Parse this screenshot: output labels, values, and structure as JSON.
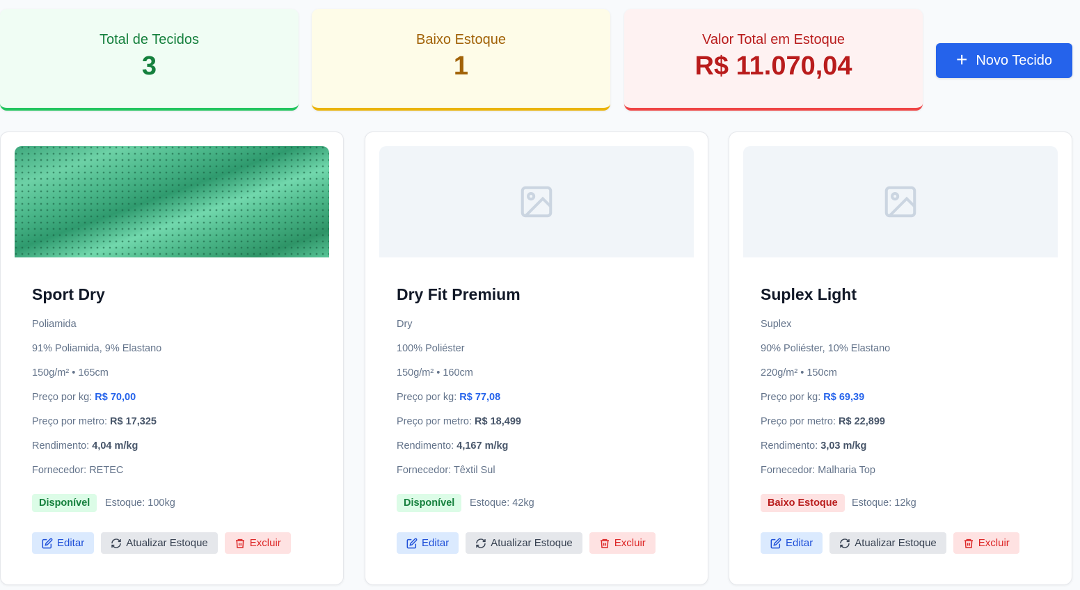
{
  "stats": {
    "total_label": "Total de Tecidos",
    "total_value": "3",
    "low_label": "Baixo Estoque",
    "low_value": "1",
    "value_label": "Valor Total em Estoque",
    "value_value": "R$ 11.070,04"
  },
  "new_button_label": "Novo Tecido",
  "colors": {
    "primary": "#2563eb",
    "green": "#22c55e",
    "yellow": "#eab308",
    "red": "#ef4444"
  },
  "cards": [
    {
      "name": "Sport Dry",
      "type": "Poliamida",
      "composition": "91% Poliamida, 9% Elastano",
      "specs": "150g/m² • 165cm",
      "price_kg_label": "Preço por kg:",
      "price_kg": "R$ 70,00",
      "price_m_label": "Preço por metro:",
      "price_m": "R$ 17,325",
      "yield_label": "Rendimento:",
      "yield": "4,04 m/kg",
      "supplier": "Fornecedor: RETEC",
      "status": "Disponível",
      "stock": "Estoque: 100kg",
      "edit": "Editar",
      "update": "Atualizar Estoque",
      "delete": "Excluir",
      "image": "green-fabric-photo"
    },
    {
      "name": "Dry Fit Premium",
      "type": "Dry",
      "composition": "100% Poliéster",
      "specs": "150g/m² • 160cm",
      "price_kg_label": "Preço por kg:",
      "price_kg": "R$ 77,08",
      "price_m_label": "Preço por metro:",
      "price_m": "R$ 18,499",
      "yield_label": "Rendimento:",
      "yield": "4,167 m/kg",
      "supplier": "Fornecedor: Têxtil Sul",
      "status": "Disponível",
      "stock": "Estoque: 42kg",
      "edit": "Editar",
      "update": "Atualizar Estoque",
      "delete": "Excluir",
      "image": "image-placeholder-icon"
    },
    {
      "name": "Suplex Light",
      "type": "Suplex",
      "composition": "90% Poliéster, 10% Elastano",
      "specs": "220g/m² • 150cm",
      "price_kg_label": "Preço por kg:",
      "price_kg": "R$ 69,39",
      "price_m_label": "Preço por metro:",
      "price_m": "R$ 22,899",
      "yield_label": "Rendimento:",
      "yield": "3,03 m/kg",
      "supplier": "Fornecedor: Malharia Top",
      "status": "Baixo Estoque",
      "stock": "Estoque: 12kg",
      "edit": "Editar",
      "update": "Atualizar Estoque",
      "delete": "Excluir",
      "image": "image-placeholder-icon"
    }
  ]
}
